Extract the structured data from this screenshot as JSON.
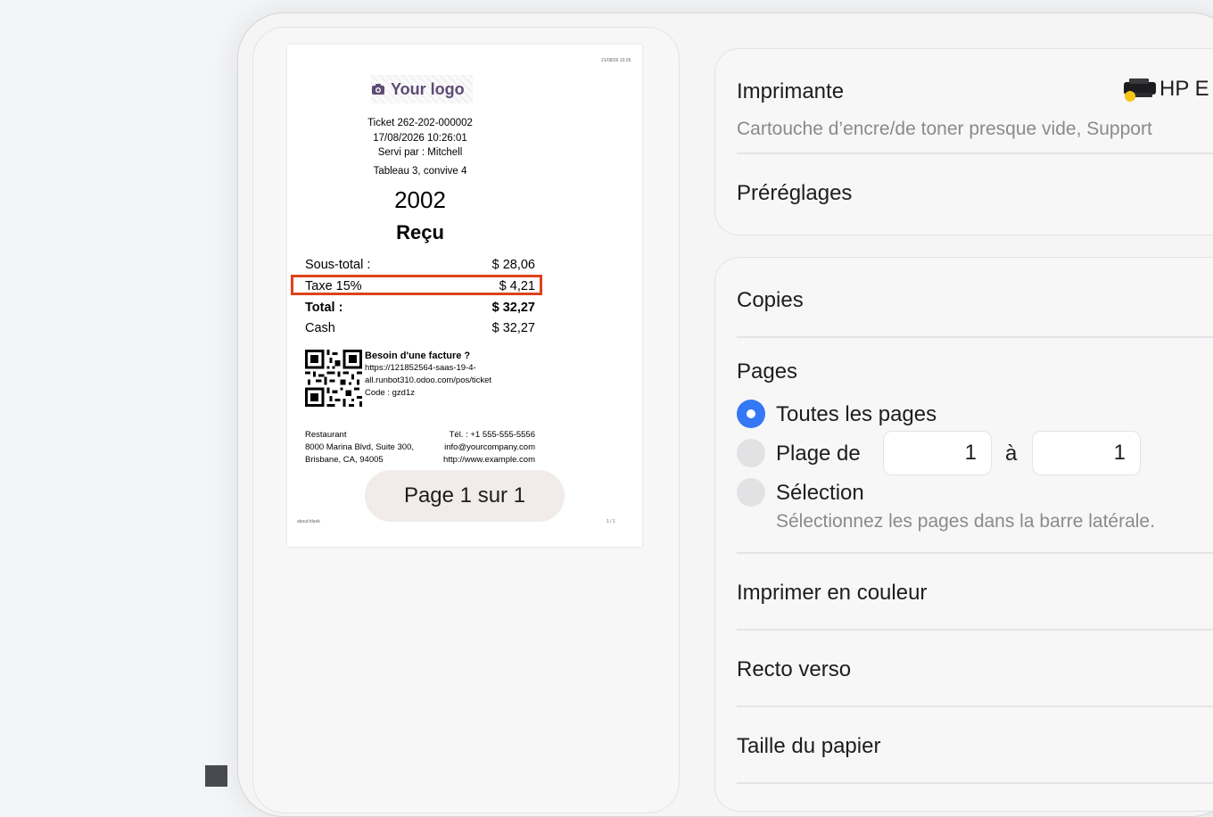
{
  "preview": {
    "logo_text": "Your logo",
    "header_date_tiny": "21/08/26 10:26",
    "ticket_number": "Ticket 262-202-000002",
    "datetime": "17/08/2026 10:26:01",
    "served_by": "Servi par : Mitchell",
    "table_info": "Tableau 3, convive 4",
    "order_number": "2002",
    "title": "Reçu",
    "rows": [
      {
        "label": "Sous-total :",
        "value": "$ 28,06"
      },
      {
        "label": "Taxe 15%",
        "value": "$ 4,21"
      },
      {
        "label": "Total :",
        "value": "$ 32,27"
      },
      {
        "label": "Cash",
        "value": "$ 32,27"
      }
    ],
    "invoice_heading": "Besoin d'une facture ?",
    "invoice_url_1": "https://121852564-saas-19-4-",
    "invoice_url_2": "all.runbot310.odoo.com/pos/ticket",
    "invoice_code": "Code : gzd1z",
    "company_name": "Restaurant",
    "company_address_1": "8000 Marina Blvd, Suite 300,",
    "company_address_2": "Brisbane, CA, 94005",
    "company_phone": "Tél. : +1 555-555-5556",
    "company_email": "info@yourcompany.com",
    "company_website": "http://www.example.com",
    "footer_left_tiny": "about:blank",
    "footer_right_tiny": "1 / 1",
    "page_indicator": "Page 1 sur 1"
  },
  "settings": {
    "printer_label": "Imprimante",
    "printer_name": "HP E",
    "printer_status": "Cartouche d’encre/de toner presque vide, Support",
    "presets_label": "Préréglages",
    "copies_label": "Copies",
    "pages_label": "Pages",
    "all_pages_label": "Toutes les pages",
    "range_label": "Plage de",
    "range_from": "1",
    "range_sep": "à",
    "range_to": "1",
    "selection_label": "Sélection",
    "selection_hint": "Sélectionnez les pages dans la barre latérale.",
    "print_color_label": "Imprimer en couleur",
    "duplex_label": "Recto verso",
    "paper_size_label": "Taille du papier",
    "selected_pages_option": "all",
    "accent_color": "#3478f6",
    "highlight_color": "#e0421b"
  }
}
